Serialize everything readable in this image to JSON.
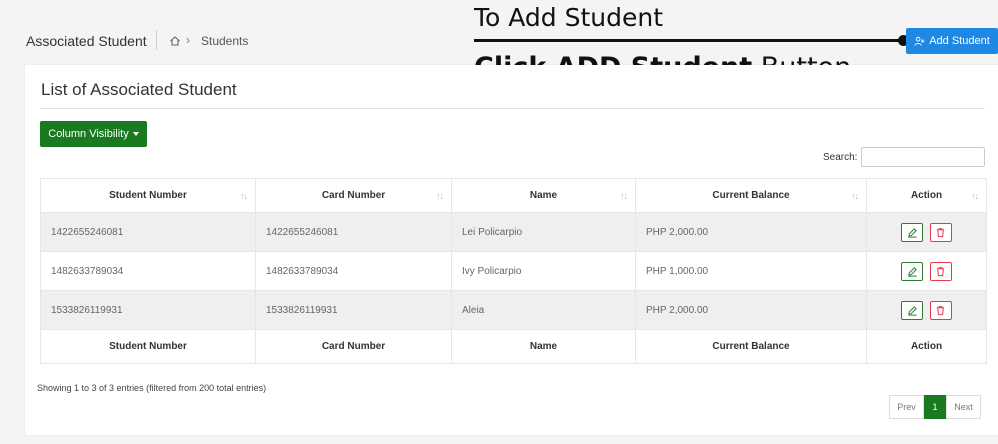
{
  "header": {
    "title": "Associated Student",
    "breadcrumb": {
      "current": "Students"
    },
    "add_button_label": "Add Student"
  },
  "annotation": {
    "line1": "To Add Student",
    "line2_bold": "Click ADD Student",
    "line2_rest": " Button"
  },
  "card": {
    "title": "List of Associated Student",
    "column_visibility_label": "Column Visibility",
    "search_label": "Search:",
    "search_value": ""
  },
  "table": {
    "columns": [
      "Student Number",
      "Card Number",
      "Name",
      "Current Balance",
      "Action"
    ],
    "rows": [
      {
        "student_number": "1422655246081",
        "card_number": "1422655246081",
        "name": "Lei Policarpio",
        "balance": "PHP 2,000.00"
      },
      {
        "student_number": "1482633789034",
        "card_number": "1482633789034",
        "name": "Ivy Policarpio",
        "balance": "PHP 1,000.00"
      },
      {
        "student_number": "1533826119931",
        "card_number": "1533826119931",
        "name": "Aleia",
        "balance": "PHP 2,000.00"
      }
    ]
  },
  "footer": {
    "info": "Showing 1 to 3 of 3 entries (filtered from 200 total entries)",
    "prev": "Prev",
    "page": "1",
    "next": "Next"
  },
  "colors": {
    "primary_blue": "#1e88e5",
    "green": "#1a7a1f",
    "danger": "#e53950"
  }
}
